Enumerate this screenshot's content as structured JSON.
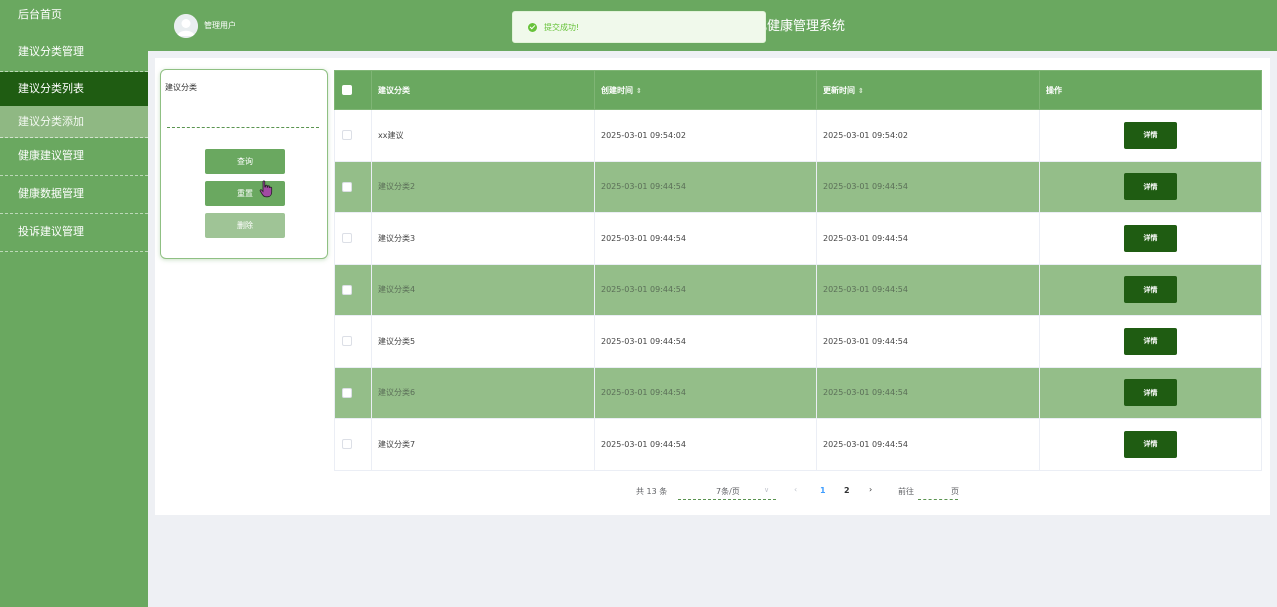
{
  "sidebar": {
    "items": [
      {
        "label": "后台首页"
      },
      {
        "label": "建议分类管理"
      },
      {
        "label": "建议分类列表"
      },
      {
        "label": "建议分类添加"
      },
      {
        "label": "健康建议管理"
      },
      {
        "label": "健康数据管理"
      },
      {
        "label": "投诉建议管理"
      }
    ]
  },
  "header": {
    "username": "管理用户",
    "title": "化健康管理系统"
  },
  "toast": {
    "message": "提交成功!",
    "icon": "check-circle-icon",
    "color": "#67c23a"
  },
  "search": {
    "label": "建议分类",
    "input_value": "",
    "query_label": "查询",
    "reset_label": "重置",
    "delete_label": "删除"
  },
  "table": {
    "headers": {
      "category": "建议分类",
      "created": "创建时间",
      "updated": "更新时间",
      "action": "操作"
    },
    "sort_icon": "⇕",
    "rows": [
      {
        "category": "xx建议",
        "created": "2025-03-01 09:54:02",
        "updated": "2025-03-01 09:54:02",
        "action": "详情"
      },
      {
        "category": "建议分类2",
        "created": "2025-03-01 09:44:54",
        "updated": "2025-03-01 09:44:54",
        "action": "详情"
      },
      {
        "category": "建议分类3",
        "created": "2025-03-01 09:44:54",
        "updated": "2025-03-01 09:44:54",
        "action": "详情"
      },
      {
        "category": "建议分类4",
        "created": "2025-03-01 09:44:54",
        "updated": "2025-03-01 09:44:54",
        "action": "详情"
      },
      {
        "category": "建议分类5",
        "created": "2025-03-01 09:44:54",
        "updated": "2025-03-01 09:44:54",
        "action": "详情"
      },
      {
        "category": "建议分类6",
        "created": "2025-03-01 09:44:54",
        "updated": "2025-03-01 09:44:54",
        "action": "详情"
      },
      {
        "category": "建议分类7",
        "created": "2025-03-01 09:44:54",
        "updated": "2025-03-01 09:44:54",
        "action": "详情"
      }
    ]
  },
  "pagination": {
    "total": "共 13 条",
    "page_size": "7条/页",
    "pages": [
      "1",
      "2"
    ],
    "current_page": 1,
    "goto_label": "前往",
    "page_label": "页"
  },
  "colors": {
    "primary": "#6aa860",
    "dark": "#1f5c12",
    "row_alt": "#94be89",
    "sub_menu": "#8fb883"
  }
}
